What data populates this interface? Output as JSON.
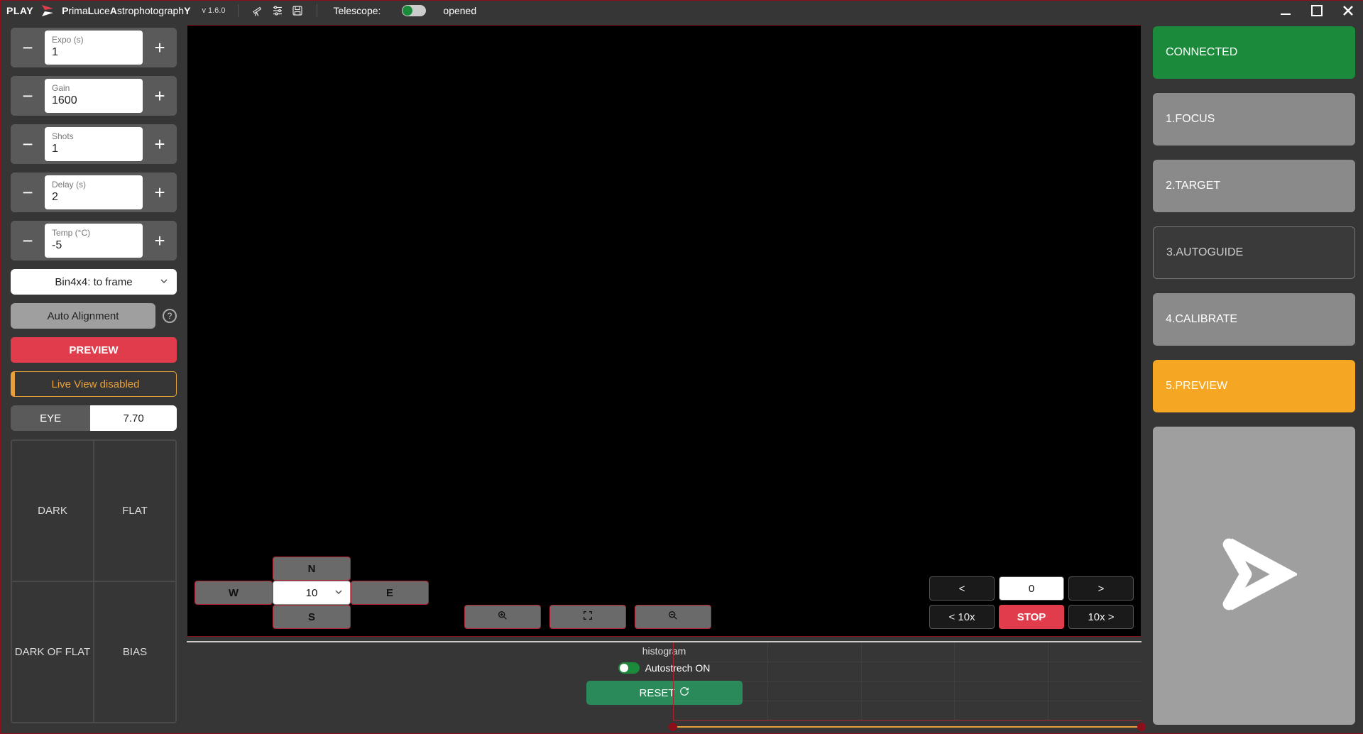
{
  "titlebar": {
    "play": "PLAY",
    "brand_html": "PrimaLuceAstrophotographY",
    "version": "v 1.6.0",
    "telescope_label": "Telescope:",
    "status": "opened"
  },
  "left": {
    "steppers": [
      {
        "label": "Expo (s)",
        "value": "1"
      },
      {
        "label": "Gain",
        "value": "1600"
      },
      {
        "label": "Shots",
        "value": "1"
      },
      {
        "label": "Delay (s)",
        "value": "2"
      },
      {
        "label": "Temp (°C)",
        "value": "-5"
      }
    ],
    "binning": "Bin4x4: to frame",
    "auto_alignment": "Auto Alignment",
    "preview": "PREVIEW",
    "liveview": "Live View disabled",
    "eye_label": "EYE",
    "eye_value": "7.70",
    "frames": {
      "dark": "DARK",
      "flat": "FLAT",
      "darkflat": "DARK OF FLAT",
      "bias": "BIAS"
    }
  },
  "nav": {
    "n": "N",
    "s": "S",
    "e": "E",
    "w": "W",
    "speed": "10",
    "rate": {
      "left": "<",
      "center": "0",
      "right": ">",
      "l10": "< 10x",
      "stop": "STOP",
      "r10": "10x >"
    }
  },
  "histo": {
    "label": "histogram",
    "autostretch": "Autostrech ON",
    "reset": "RESET"
  },
  "right": {
    "connected": "CONNECTED",
    "focus": "1.FOCUS",
    "target": "2.TARGET",
    "autoguide": "3.AUTOGUIDE",
    "calibrate": "4.CALIBRATE",
    "preview": "5.PREVIEW"
  }
}
